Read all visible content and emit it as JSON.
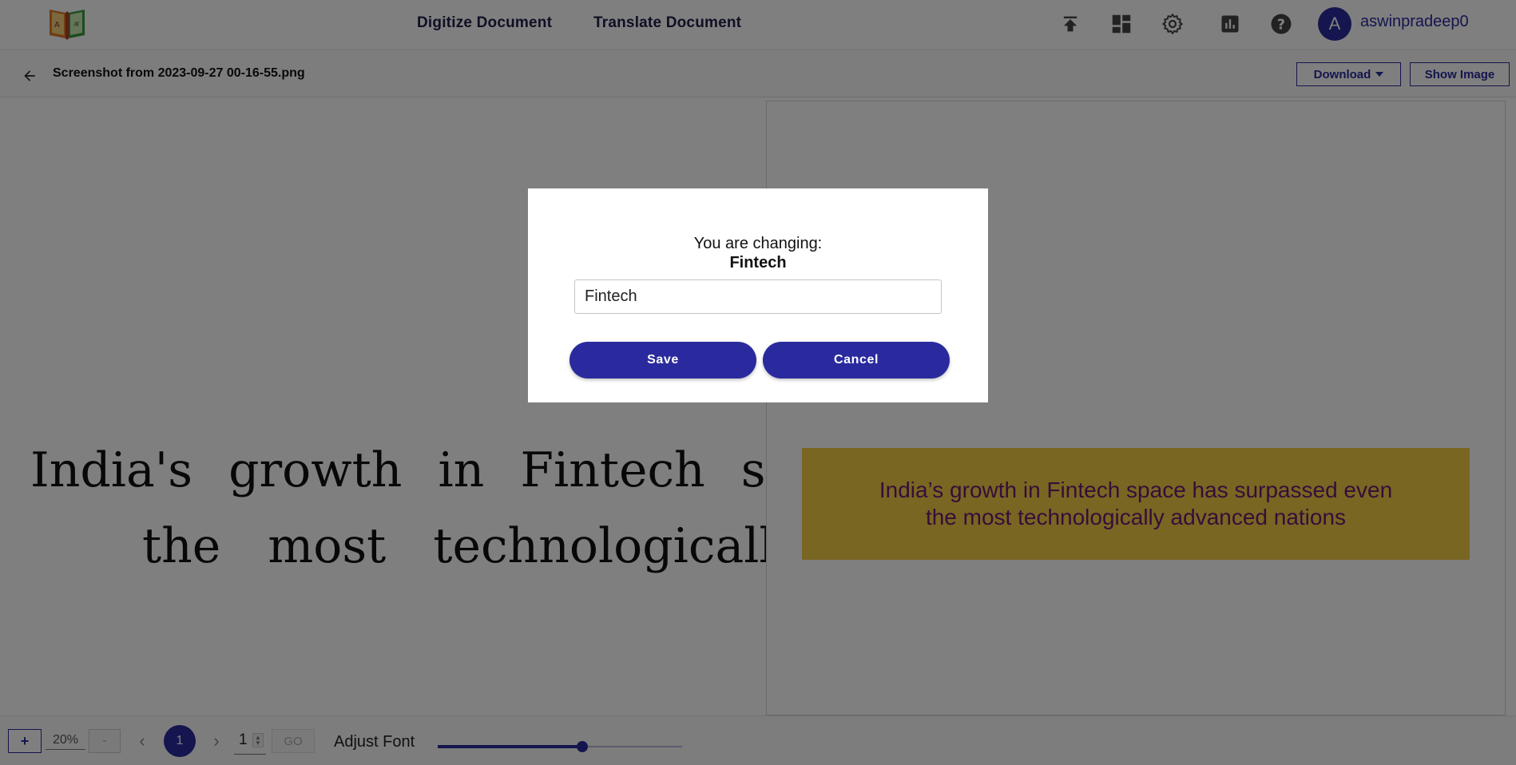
{
  "header": {
    "nav": {
      "digitize_label": "Digitize Document",
      "translate_label": "Translate Document"
    },
    "icons": [
      "upload-icon",
      "dashboard-icon",
      "settings-gear-icon",
      "analytics-chart-icon",
      "help-icon"
    ],
    "user": {
      "avatar_letter": "A",
      "username": "aswinpradeep0"
    }
  },
  "toolbar": {
    "filename": "Screenshot from 2023-09-27 00-16-55.png",
    "download_label": "Download",
    "show_image_label": "Show Image"
  },
  "document": {
    "line1": "India's growth in Fintech s",
    "line2": "the most technologicall"
  },
  "source_image": {
    "line1": "India’s growth in Fintech space has surpassed even",
    "line2": "the most technologically advanced nations"
  },
  "pagination": {
    "zoom_in_label": "+",
    "zoom_value": "20%",
    "zoom_out_label": "-",
    "prev_label": "‹",
    "current_page": "1",
    "next_label": "›",
    "page_input_value": "1",
    "go_label": "GO",
    "adjust_font_label": "Adjust Font",
    "font_slider_percent": 59
  },
  "modal": {
    "title": "You are changing:",
    "word": "Fintech",
    "input_value": "Fintech",
    "save_label": "Save",
    "cancel_label": "Cancel"
  },
  "colors": {
    "primary": "#2a2a9e",
    "overlay": "rgba(0,0,0,0.5)",
    "image_background": "#f2cd45",
    "image_text": "#6a1d74"
  }
}
